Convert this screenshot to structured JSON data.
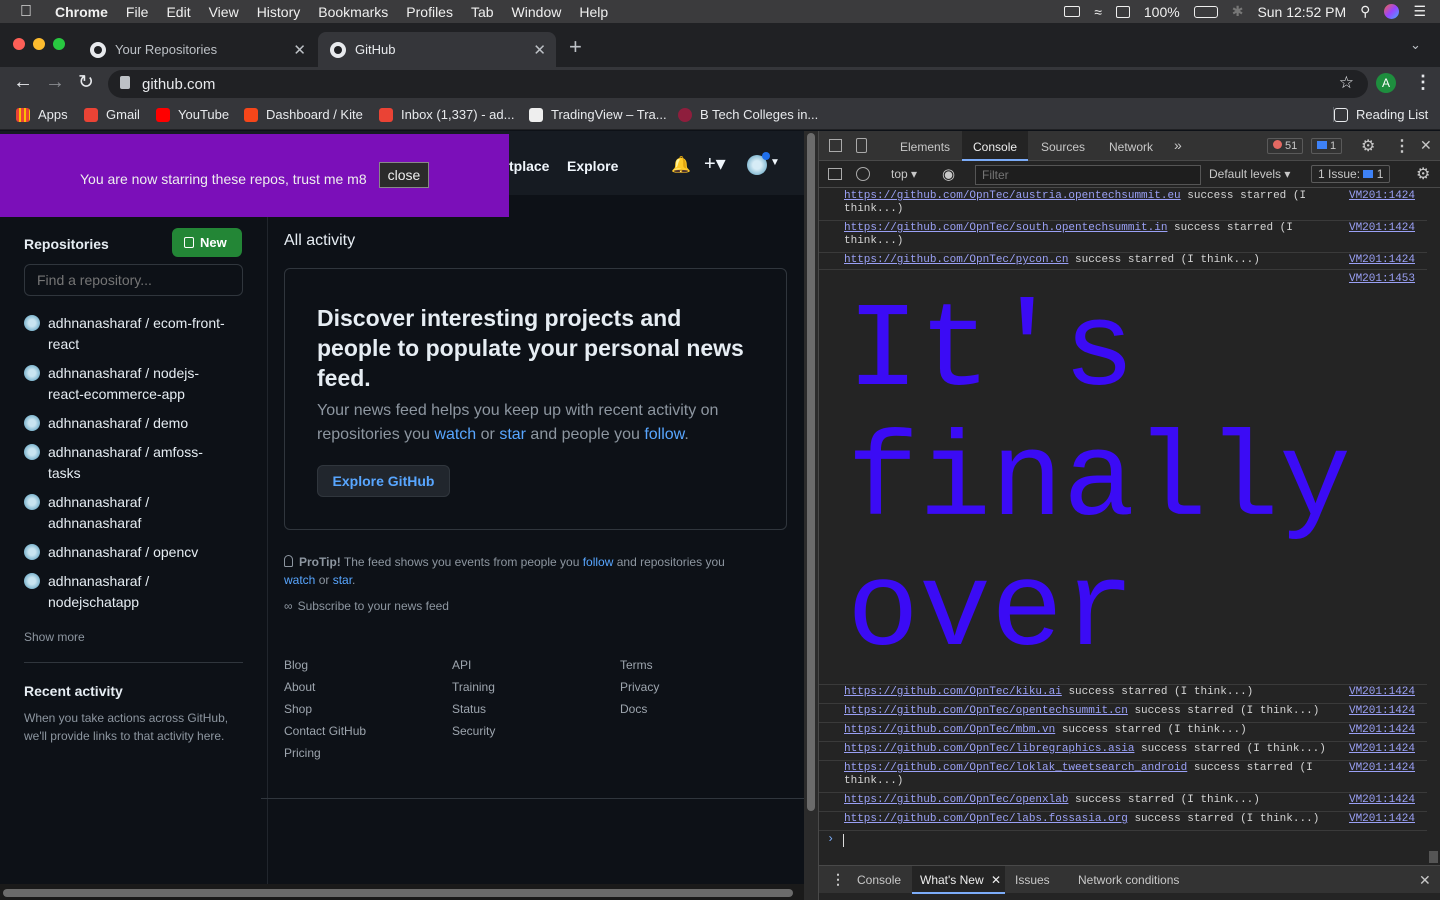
{
  "menubar": {
    "app": "Chrome",
    "items": [
      "File",
      "Edit",
      "View",
      "History",
      "Bookmarks",
      "Profiles",
      "Tab",
      "Window",
      "Help"
    ],
    "battery": "100%",
    "clock": "Sun 12:52 PM"
  },
  "tabs": [
    {
      "title": "Your Repositories"
    },
    {
      "title": "GitHub"
    }
  ],
  "address": {
    "url": "github.com",
    "avatar_letter": "A"
  },
  "bookmarks": [
    "Apps",
    "Gmail",
    "YouTube",
    "Dashboard / Kite",
    "Inbox (1,337) - ad...",
    "TradingView – Tra...",
    "B Tech Colleges in..."
  ],
  "reading_list": "Reading List",
  "banner": {
    "text": "You are now starring these repos, trust me m8",
    "close": "close"
  },
  "header": {
    "nav_marketplace": "tplace",
    "nav_explore": "Explore"
  },
  "sidebar": {
    "title": "Repositories",
    "new_button": "New",
    "search_placeholder": "Find a repository...",
    "repos": [
      {
        "line1": "adhnanasharaf / ecom-front-",
        "line2": "react"
      },
      {
        "line1": "adhnanasharaf / nodejs-",
        "line2": "react-ecommerce-app"
      },
      {
        "line1": "adhnanasharaf / demo",
        "line2": ""
      },
      {
        "line1": "adhnanasharaf / amfoss-",
        "line2": "tasks"
      },
      {
        "line1": "adhnanasharaf /",
        "line2": "adhnanasharaf"
      },
      {
        "line1": "adhnanasharaf / opencv",
        "line2": ""
      },
      {
        "line1": "adhnanasharaf /",
        "line2": "nodejschatapp"
      }
    ],
    "show_more": "Show more",
    "recent_title": "Recent activity",
    "recent_text_1": "When you take actions across GitHub,",
    "recent_text_2": "we'll provide links to that activity here."
  },
  "main": {
    "heading": "All activity",
    "card_title_1": "Discover interesting projects and",
    "card_title_2": "people to populate your personal news",
    "card_title_3": "feed.",
    "card_text_1": "Your news feed helps you keep up with recent activity on",
    "card_text_2a": "repositories you ",
    "card_link_watch": "watch",
    "card_text_2b": " or ",
    "card_link_star": "star",
    "card_text_2c": " and people you ",
    "card_link_follow": "follow",
    "card_text_2d": ".",
    "explore_button": "Explore GitHub",
    "protip_label": "ProTip!",
    "protip_text_a": " The feed shows you events from people you ",
    "protip_follow": "follow",
    "protip_text_b": " and repositories you",
    "protip_watch": "watch",
    "protip_or": " or ",
    "protip_star": "star",
    "protip_dot": ".",
    "subscribe": "Subscribe to your news feed"
  },
  "footer": {
    "col1": [
      "Blog",
      "About",
      "Shop",
      "Contact GitHub",
      "Pricing"
    ],
    "col2": [
      "API",
      "Training",
      "Status",
      "Security"
    ],
    "col3": [
      "Terms",
      "Privacy",
      "Docs"
    ]
  },
  "devtools": {
    "tabs": [
      "Elements",
      "Console",
      "Sources",
      "Network"
    ],
    "error_count": "51",
    "msg_count": "1",
    "context": "top",
    "filter_placeholder": "Filter",
    "levels": "Default levels",
    "issues_label": "1 Issue:",
    "issues_count": "1",
    "logs_top": [
      {
        "url": "https://github.com/OpnTec/austria.opentechsummit.eu",
        "msg": " success starred (I",
        "cont": "think...)",
        "src": "VM201:1424"
      },
      {
        "url": "https://github.com/OpnTec/south.opentechsummit.in",
        "msg": " success starred (I",
        "cont": "think...)",
        "src": "VM201:1424"
      },
      {
        "url": "https://github.com/OpnTec/pycon.cn",
        "msg": " success starred (I think...)",
        "cont": "",
        "src": "VM201:1424"
      }
    ],
    "big_src": "VM201:1453",
    "big_line1": "It's",
    "big_line2": "finally",
    "big_line3": "over",
    "logs_bottom": [
      {
        "url": "https://github.com/OpnTec/kiku.ai",
        "msg": " success starred (I think...)",
        "cont": "",
        "src": "VM201:1424"
      },
      {
        "url": "https://github.com/OpnTec/opentechsummit.cn",
        "msg": " success starred (I think...)",
        "cont": "",
        "src": "VM201:1424"
      },
      {
        "url": "https://github.com/OpnTec/mbm.vn",
        "msg": " success starred (I think...)",
        "cont": "",
        "src": "VM201:1424"
      },
      {
        "url": "https://github.com/OpnTec/libregraphics.asia",
        "msg": " success starred (I think...)",
        "cont": "",
        "src": "VM201:1424"
      },
      {
        "url": "https://github.com/OpnTec/loklak_tweetsearch_android",
        "msg": " success starred (I",
        "cont": "think...)",
        "src": "VM201:1424"
      },
      {
        "url": "https://github.com/OpnTec/openxlab",
        "msg": " success starred (I think...)",
        "cont": "",
        "src": "VM201:1424"
      },
      {
        "url": "https://github.com/OpnTec/labs.fossasia.org",
        "msg": " success starred (I think...)",
        "cont": "",
        "src": "VM201:1424"
      }
    ],
    "drawer_tabs": [
      "Console",
      "What's New",
      "Issues",
      "Network conditions"
    ]
  },
  "colors": {
    "banner": "#7b0fb9",
    "big_text": "#3b0bf5",
    "new_button": "#238636",
    "link": "#58a6ff"
  }
}
